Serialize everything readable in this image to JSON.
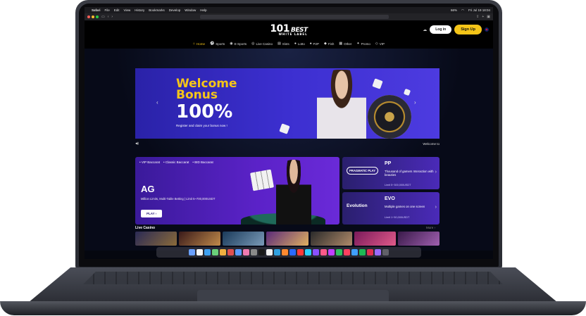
{
  "menubar": {
    "app": "Safari",
    "items": [
      "File",
      "Edit",
      "View",
      "History",
      "Bookmarks",
      "Develop",
      "Window",
      "Help"
    ],
    "battery": "66%",
    "datetime": "Fri Jul 19 18:04"
  },
  "header": {
    "logo_number": "101",
    "logo_word": "BEST",
    "logo_sub": "WHITE LABEL",
    "login_label": "Log in",
    "signup_label": "Sign Up"
  },
  "nav": {
    "items": [
      {
        "label": "Home",
        "icon": "home-icon",
        "glyph": "⌂"
      },
      {
        "label": "Sports",
        "icon": "soccer-ball-icon",
        "glyph": "⚽"
      },
      {
        "label": "E-Sports",
        "icon": "gamepad-icon",
        "glyph": "◉"
      },
      {
        "label": "Live Casino",
        "icon": "casino-chip-icon",
        "glyph": "◎"
      },
      {
        "label": "Slots",
        "icon": "slot-machine-icon",
        "glyph": "▤"
      },
      {
        "label": "Lotto",
        "icon": "lotto-ball-icon",
        "glyph": "●"
      },
      {
        "label": "P2P",
        "icon": "cards-icon",
        "glyph": "♠"
      },
      {
        "label": "Fish",
        "icon": "fish-icon",
        "glyph": "◆"
      },
      {
        "label": "Other",
        "icon": "grid-icon",
        "glyph": "▦"
      },
      {
        "label": "Promo",
        "icon": "gift-icon",
        "glyph": "✦"
      },
      {
        "label": "VIP",
        "icon": "diamond-icon",
        "glyph": "◇"
      }
    ],
    "active": "Home"
  },
  "banner": {
    "title_line1": "Welcome",
    "title_line2": "Bonus",
    "percent": "100%",
    "subtitle": "Register and claim your bonus now !"
  },
  "ticker": {
    "speaker_glyph": "🔊",
    "text": "Welcome to"
  },
  "ag_card": {
    "tags": [
      "VIP Baccarat",
      "Classic Baccarat",
      "BID Baccarat"
    ],
    "title": "AG",
    "description": "Million Limits, Multi-Table Betting | Limit 5~700,000USDT",
    "play_label": "PLAY"
  },
  "providers": [
    {
      "brand": "PRAGMATIC PLAY",
      "name": "PP",
      "desc": "Thousand of gamers Interaction with beauties",
      "limit": "Limit 5~300,000USDT"
    },
    {
      "brand": "Evolution",
      "name": "EVO",
      "desc": "Multiple games on one screen",
      "limit": "Limit 1~50,000USDT"
    }
  ],
  "live_casino": {
    "title": "Live Casino",
    "more": "More"
  },
  "colors": {
    "accent": "#f5c518",
    "banner": "#3c2fd0",
    "card": "#5b22c8",
    "page_bg": "#05070f"
  }
}
